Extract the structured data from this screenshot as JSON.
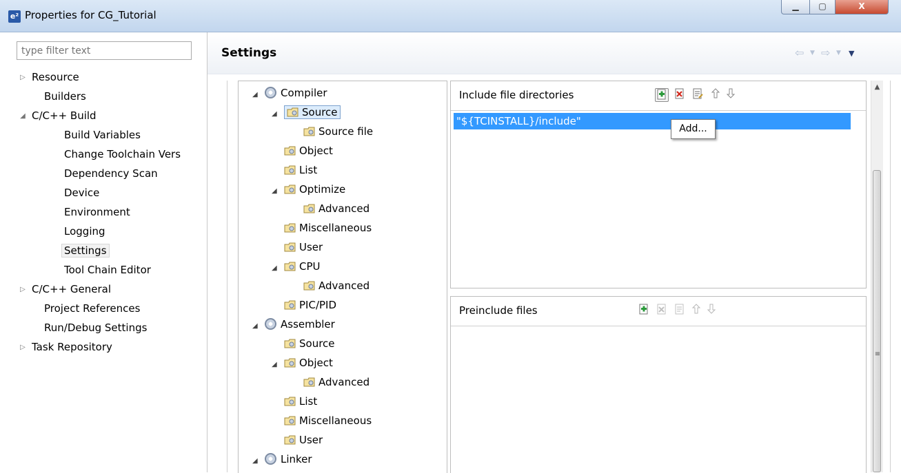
{
  "window": {
    "app_icon_label": "e²",
    "title": "Properties for CG_Tutorial",
    "minimize_symbol": "▁",
    "maximize_symbol": "▢",
    "close_symbol": "X"
  },
  "sidebar": {
    "filter_placeholder": "type filter text",
    "items": [
      {
        "label": "Resource"
      },
      {
        "label": "Builders"
      },
      {
        "label": "C/C++ Build"
      },
      {
        "label": "Build Variables"
      },
      {
        "label": "Change Toolchain Vers"
      },
      {
        "label": "Dependency Scan"
      },
      {
        "label": "Device"
      },
      {
        "label": "Environment"
      },
      {
        "label": "Logging"
      },
      {
        "label": "Settings"
      },
      {
        "label": "Tool Chain Editor"
      },
      {
        "label": "C/C++ General"
      },
      {
        "label": "Project References"
      },
      {
        "label": "Run/Debug Settings"
      },
      {
        "label": "Task Repository"
      }
    ]
  },
  "header": {
    "title": "Settings",
    "nav_back_symbol": "⇦",
    "nav_forward_symbol": "⇨",
    "menu_symbol": "▼"
  },
  "tool_tree": {
    "items": [
      {
        "label": "Compiler"
      },
      {
        "label": "Source"
      },
      {
        "label": "Source file"
      },
      {
        "label": "Object"
      },
      {
        "label": "List"
      },
      {
        "label": "Optimize"
      },
      {
        "label": "Advanced"
      },
      {
        "label": "Miscellaneous"
      },
      {
        "label": "User"
      },
      {
        "label": "CPU"
      },
      {
        "label": "Advanced"
      },
      {
        "label": "PIC/PID"
      },
      {
        "label": "Assembler"
      },
      {
        "label": "Source"
      },
      {
        "label": "Object"
      },
      {
        "label": "Advanced"
      },
      {
        "label": "List"
      },
      {
        "label": "Miscellaneous"
      },
      {
        "label": "User"
      },
      {
        "label": "Linker"
      }
    ]
  },
  "include_dirs": {
    "label": "Include file directories",
    "entries": [
      "\"${TCINSTALL}/include\""
    ],
    "tooltip": "Add..."
  },
  "preinclude": {
    "label": "Preinclude files"
  },
  "toolbar_icons": {
    "add": "add-icon",
    "delete": "delete-icon",
    "edit": "edit-icon",
    "move_up": "move-up-icon",
    "move_down": "move-down-icon"
  },
  "colors": {
    "selection": "#3399ff",
    "title_bar": "#c2d6ee",
    "close_button": "#c74a30"
  }
}
